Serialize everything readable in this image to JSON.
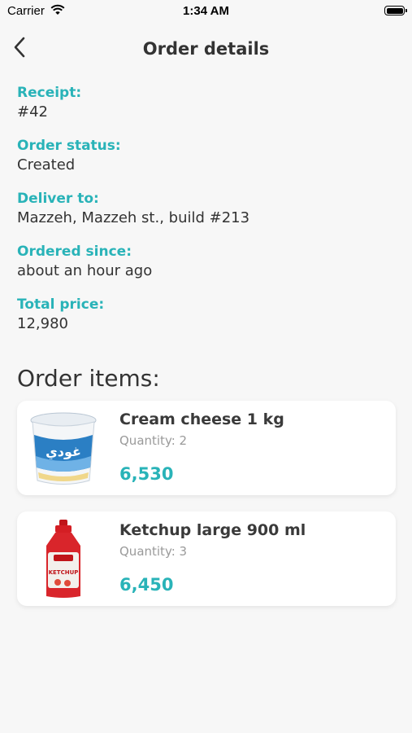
{
  "status_bar": {
    "carrier": "Carrier",
    "time": "1:34 AM"
  },
  "nav": {
    "title": "Order details",
    "back_icon": "chevron-left-icon"
  },
  "details": [
    {
      "label": "Receipt:",
      "value": "#42"
    },
    {
      "label": "Order status:",
      "value": "Created"
    },
    {
      "label": "Deliver to:",
      "value": "Mazzeh, Mazzeh st., build #213"
    },
    {
      "label": "Ordered since:",
      "value": "about an hour ago"
    },
    {
      "label": "Total price:",
      "value": "12,980"
    }
  ],
  "items_section": {
    "title": "Order items:"
  },
  "items": [
    {
      "name": "Cream cheese 1 kg",
      "quantity": "Quantity: 2",
      "price": "6,530",
      "image_icon": "cream-cheese-tub-image",
      "brand_text": "غودي"
    },
    {
      "name": "Ketchup large 900 ml",
      "quantity": "Quantity: 3",
      "price": "6,450",
      "image_icon": "ketchup-bottle-image",
      "brand_text": "KETCHUP"
    }
  ],
  "colors": {
    "accent": "#29b3b8",
    "background": "#f7f7f7",
    "card": "#ffffff",
    "text": "#333333",
    "muted": "#9a9a9a"
  }
}
